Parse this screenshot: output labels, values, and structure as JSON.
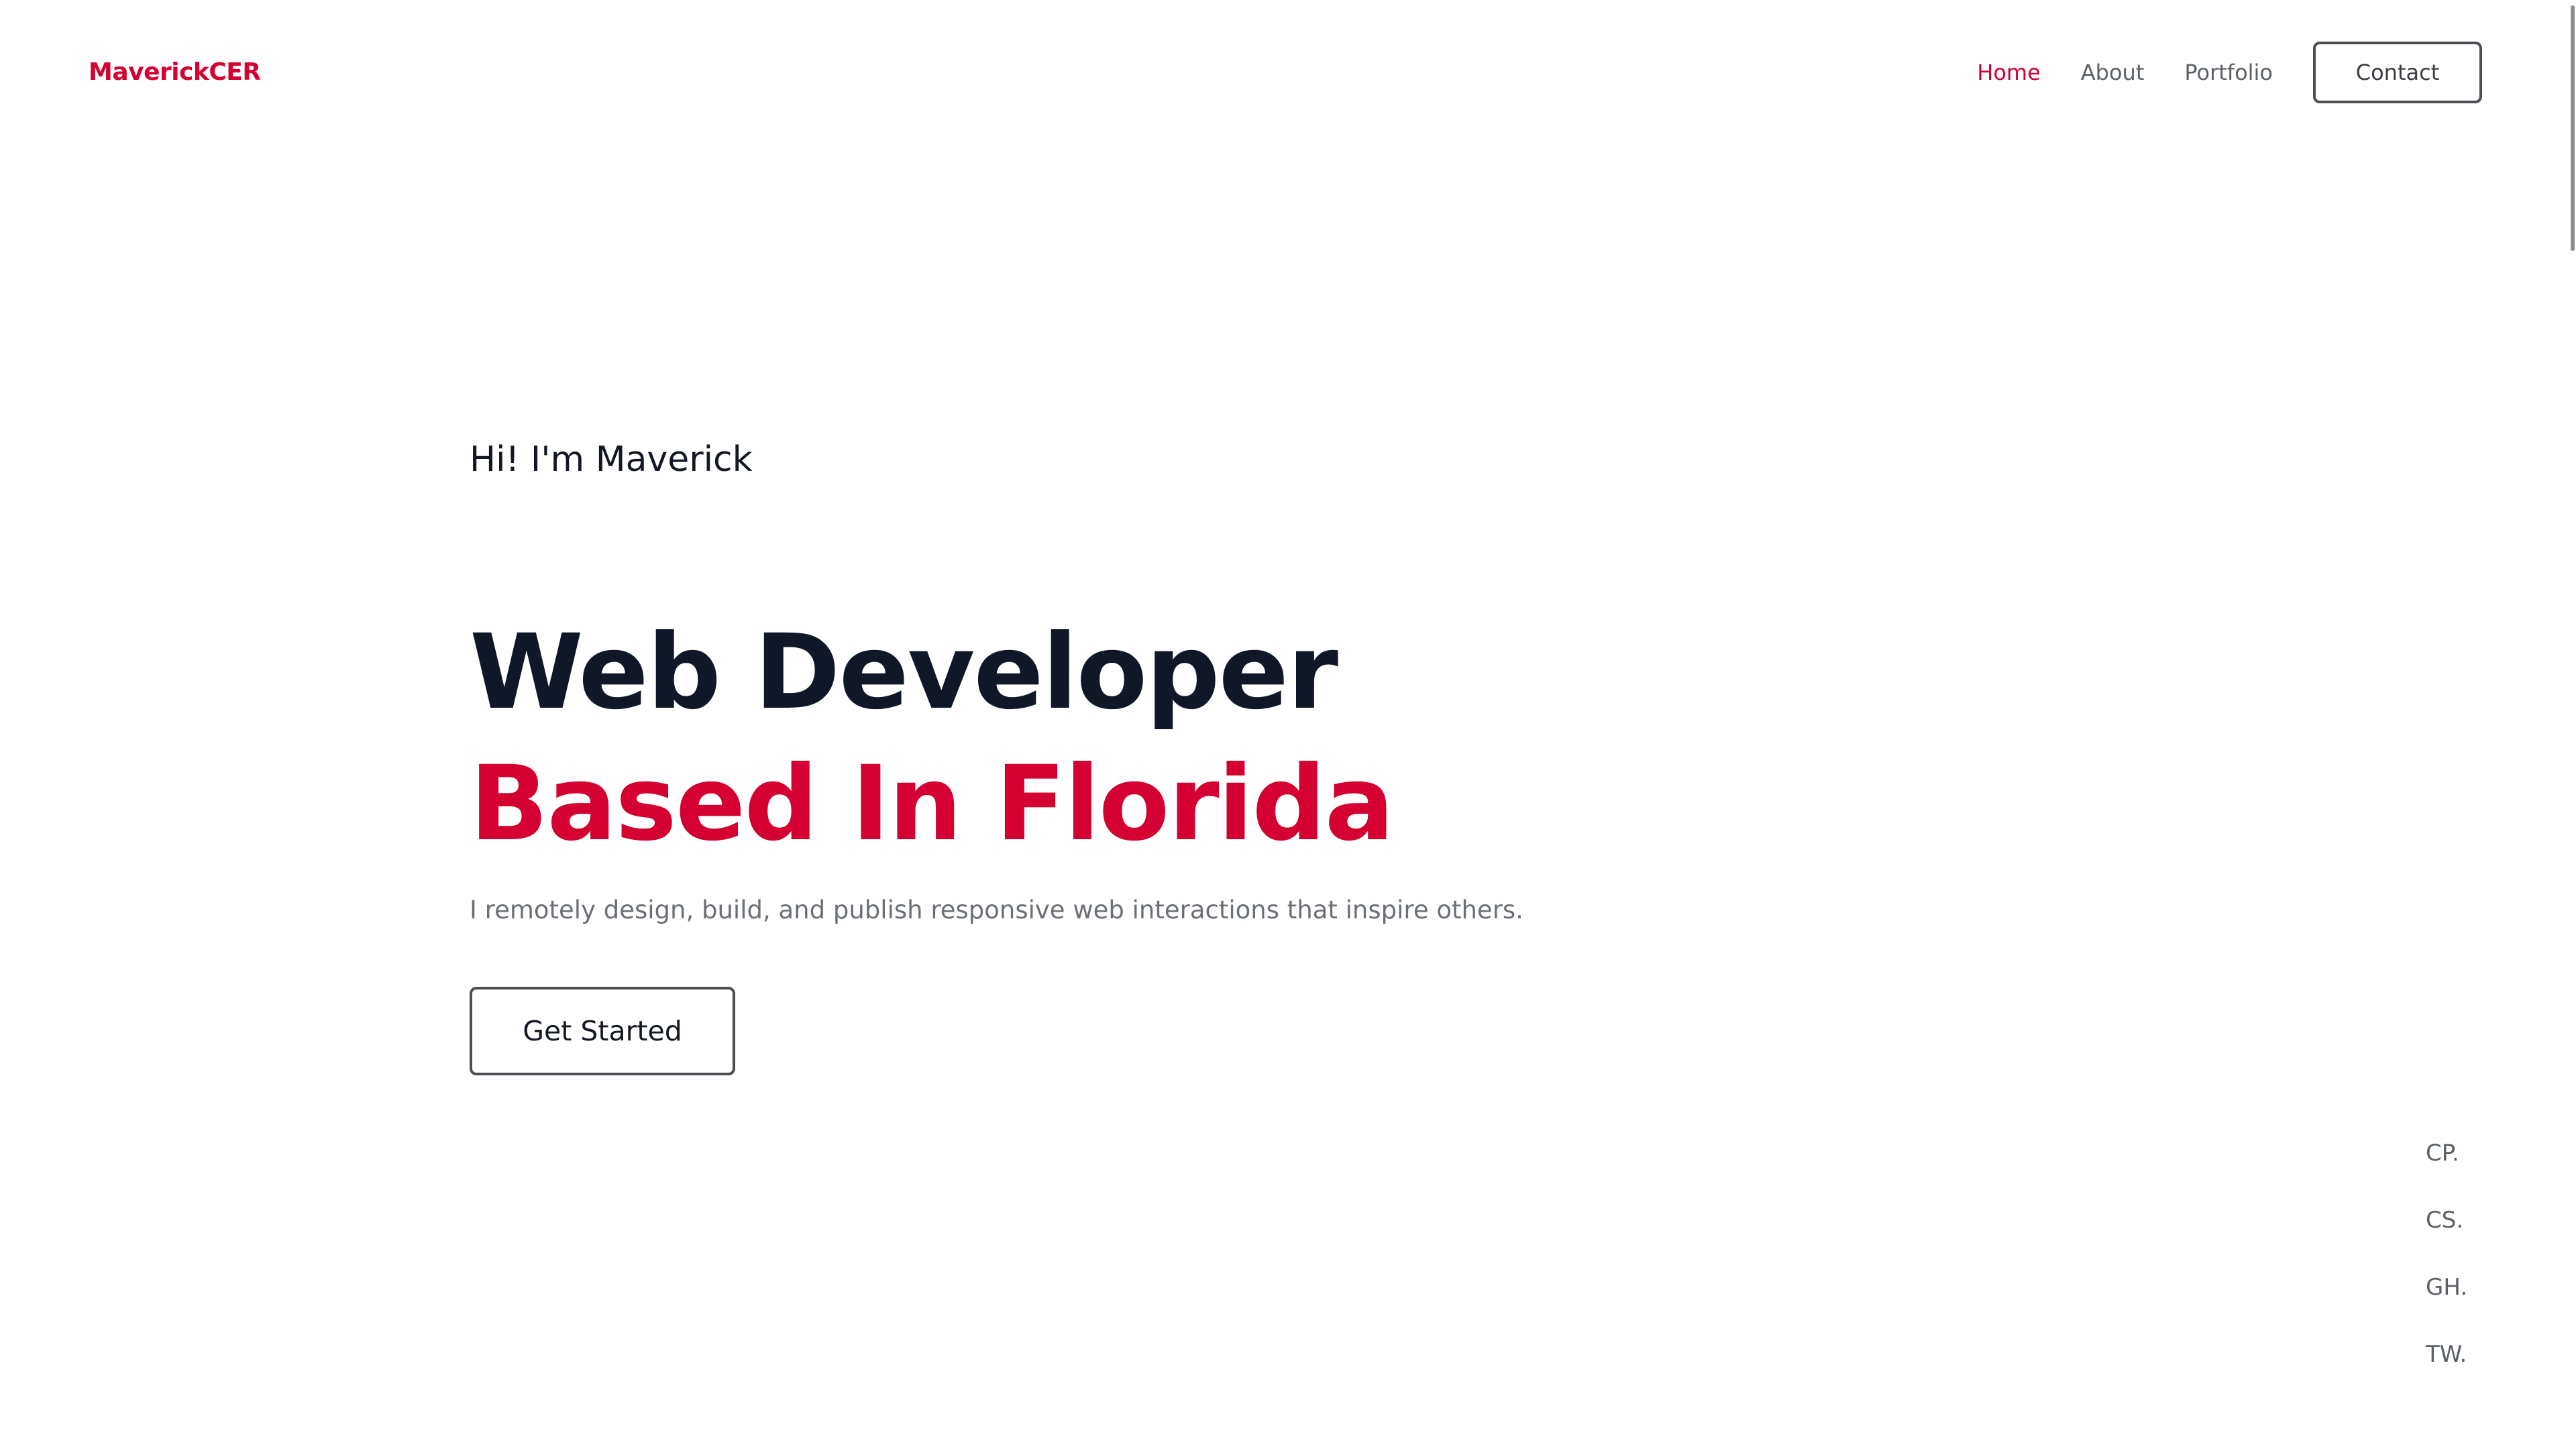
{
  "header": {
    "logo": "MaverickCER",
    "nav": [
      {
        "label": "Home",
        "active": true
      },
      {
        "label": "About",
        "active": false
      },
      {
        "label": "Portfolio",
        "active": false
      }
    ],
    "contact_label": "Contact"
  },
  "hero": {
    "greeting": "Hi! I'm Maverick",
    "headline_line1": "Web Developer",
    "headline_line2": "Based In Florida",
    "subtitle": "I remotely design, build, and publish responsive web interactions that inspire others.",
    "cta_label": "Get Started"
  },
  "social": [
    "CP.",
    "CS.",
    "GH.",
    "TW."
  ],
  "colors": {
    "accent": "#d40032",
    "heading": "#101827",
    "muted": "#6b6f76"
  }
}
